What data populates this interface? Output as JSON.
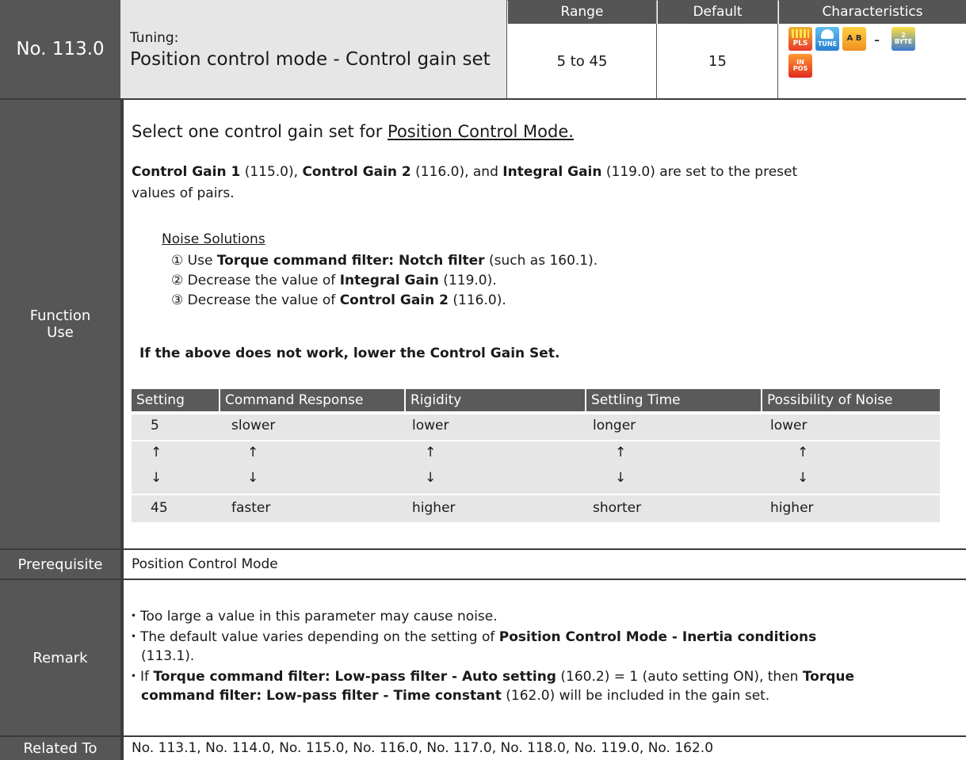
{
  "param": {
    "number": "No. 113.0",
    "subtitle": "Tuning:",
    "name": "Position control mode - Control gain set"
  },
  "header": {
    "range_label": "Range",
    "default_label": "Default",
    "characteristics_label": "Characteristics",
    "range_value": "5 to 45",
    "default_value": "15",
    "characteristics_separator": "-"
  },
  "icons": [
    {
      "name": "pls",
      "label": "PLS",
      "color": "#e8352c"
    },
    {
      "name": "tune",
      "label": "TUNE",
      "color": "#2a8fd8"
    },
    {
      "name": "ab",
      "label": "A B",
      "color": "#f0a020"
    },
    {
      "name": "2byte",
      "label": "2 BYTE",
      "color": "#3070c8"
    },
    {
      "name": "in-pos",
      "label": "IN POS",
      "color": "#e04020"
    }
  ],
  "labels": {
    "function_use_1": "Function",
    "function_use_2": "Use",
    "prerequisite": "Prerequisite",
    "remark": "Remark",
    "related_to": "Related To"
  },
  "function": {
    "heading_prefix": "Select one control gain set for ",
    "heading_link": "Position Control Mode.",
    "para_cg1": "Control Gain 1",
    "para_cg1_num": " (115.0), ",
    "para_cg2": "Control Gain 2",
    "para_cg2_num": " (116.0), and ",
    "para_ig": "Integral Gain",
    "para_ig_num": " (119.0) are set to the preset",
    "para_line2": "values of pairs.",
    "noise_title": "Noise Solutions",
    "noise_1_prefix": "① Use ",
    "noise_1_bold": "Torque command filter: Notch filter",
    "noise_1_suffix": " (such as 160.1).",
    "noise_2_prefix": "② Decrease the value of ",
    "noise_2_bold": "Integral Gain",
    "noise_2_suffix": " (119.0).",
    "noise_3_prefix": "③ Decrease the value of ",
    "noise_3_bold": "Control Gain 2",
    "noise_3_suffix": " (116.0).",
    "fallback": "If the above does not work, lower the Control Gain Set."
  },
  "table": {
    "headers": [
      "Setting",
      "Command Response",
      "Rigidity",
      "Settling Time",
      "Possibility of Noise"
    ],
    "row_min": [
      "5",
      "slower",
      "lower",
      "longer",
      "lower"
    ],
    "up_arrow": "↑",
    "down_arrow": "↓",
    "row_max": [
      "45",
      "faster",
      "higher",
      "shorter",
      "higher"
    ]
  },
  "prerequisite": "Position Control Mode",
  "remark": {
    "r1": "・Too large a value in this parameter may cause noise.",
    "r2_prefix": "・The default value varies depending on the setting of ",
    "r2_bold": "Position Control Mode - Inertia conditions",
    "r2_line2": "(113.1).",
    "r3_prefix": "・If ",
    "r3_bold1": "Torque command filter: Low-pass filter - Auto setting",
    "r3_mid": " (160.2) = 1 (auto setting ON), then ",
    "r3_bold2": "Torque",
    "r3_line2_bold": "command filter: Low-pass filter - Time constant",
    "r3_line2_suffix": " (162.0) will be included in the gain set."
  },
  "related": "No. 113.1, No. 114.0, No. 115.0, No. 116.0, No. 117.0, No. 118.0, No. 119.0, No. 162.0"
}
